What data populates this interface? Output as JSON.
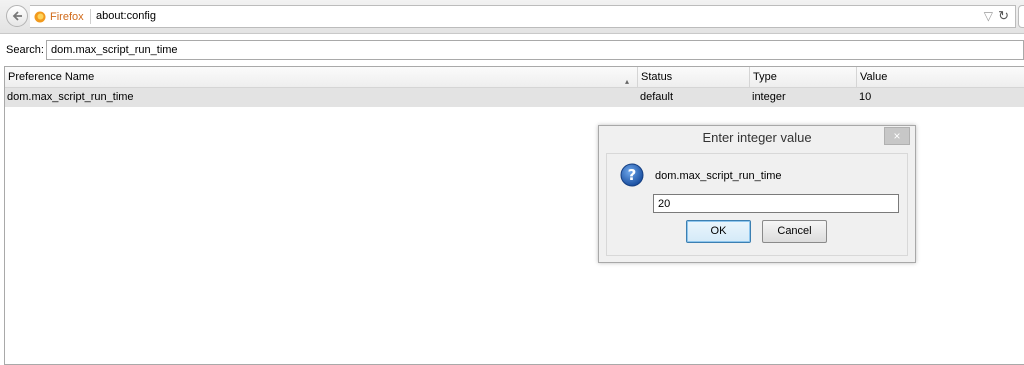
{
  "browser": {
    "identity_label": "Firefox",
    "url": "about:config",
    "icons": {
      "back": "back-arrow-icon",
      "identity": "firefox-icon",
      "bookmark": "star-icon",
      "reload": "reload-icon"
    }
  },
  "search": {
    "label": "Search:",
    "value": "dom.max_script_run_time"
  },
  "table": {
    "columns": [
      "Preference Name",
      "Status",
      "Type",
      "Value"
    ],
    "sort_indicator": "▴",
    "rows": [
      {
        "name": "dom.max_script_run_time",
        "status": "default",
        "type": "integer",
        "value": "10"
      }
    ]
  },
  "dialog": {
    "title": "Enter integer value",
    "close_label": "×",
    "pref_name": "dom.max_script_run_time",
    "input_value": "20",
    "ok_label": "OK",
    "cancel_label": "Cancel",
    "icon": "question-icon"
  },
  "colors": {
    "accent_orange": "#d06a1a",
    "row_highlight": "#e3e3e3",
    "question_blue": "#1f5fb4"
  }
}
